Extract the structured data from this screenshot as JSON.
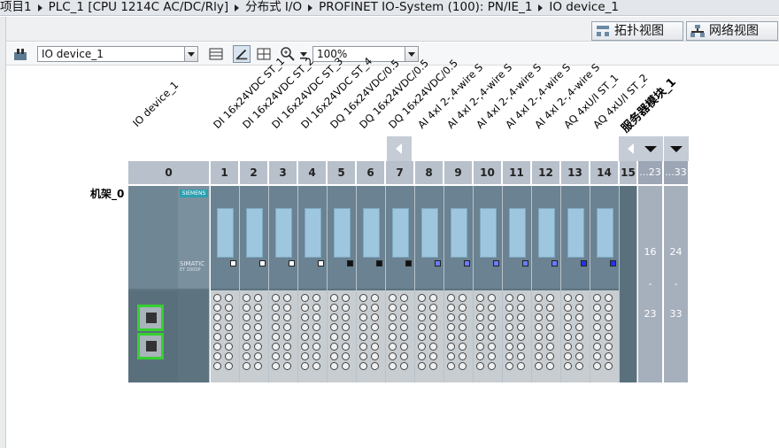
{
  "breadcrumb": [
    "项目1",
    "PLC_1 [CPU 1214C AC/DC/Rly]",
    "分布式 I/O",
    "PROFINET IO-System (100): PN/IE_1",
    "IO device_1"
  ],
  "view_buttons": {
    "topology": "拓扑视图",
    "network": "网络视图"
  },
  "toolbar": {
    "device_select": "IO device_1",
    "zoom": "100%"
  },
  "device": {
    "name": "IO device_1",
    "rack_label": "机架_0",
    "brand": "SIEMENS",
    "product": "SIMATIC",
    "product_model": "ET 200SP"
  },
  "module_names": [
    "DI 16x24VDC ST_1",
    "DI 16x24VDC ST_2",
    "DI 16x24VDC ST_3",
    "DI 16x24VDC ST_4",
    "DQ 16x24VDC/0.5",
    "DQ 16x24VDC/0.5",
    "DQ 16x24VDC/0.5",
    "AI 4xI 2-,4-wire S",
    "AI 4xI 2-,4-wire S",
    "AI 4xI 2-,4-wire S",
    "AI 4xI 2-,4-wire S",
    "AI 4xI 2-,4-wire S",
    "AQ 4xU/I ST_1",
    "AQ 4xU/I ST_2",
    "服务器模块_1"
  ],
  "slot_numbers": [
    "0",
    "1",
    "2",
    "3",
    "4",
    "5",
    "6",
    "7",
    "8",
    "9",
    "10",
    "11",
    "12",
    "13",
    "14",
    "15"
  ],
  "ghost_slots": [
    {
      "header": "...23",
      "top": "16",
      "dash": "-",
      "bottom": "23"
    },
    {
      "header": "...33",
      "top": "24",
      "dash": "-",
      "bottom": "33"
    }
  ],
  "colors": {
    "module_body": "#6a8291",
    "terminal_block": "#c8cdd1",
    "port_green": "#35d030",
    "di_marker": "#ffffff",
    "dq_marker": "#111111",
    "ai_marker": "#6a7cff",
    "aq_marker": "#2233ee"
  },
  "icons": [
    "device-icon",
    "grid-icon",
    "draw-icon",
    "table-icon",
    "zoom-icon",
    "download-icon",
    "topology-icon",
    "network-icon",
    "nav-left-icon",
    "nav-down-icon"
  ]
}
